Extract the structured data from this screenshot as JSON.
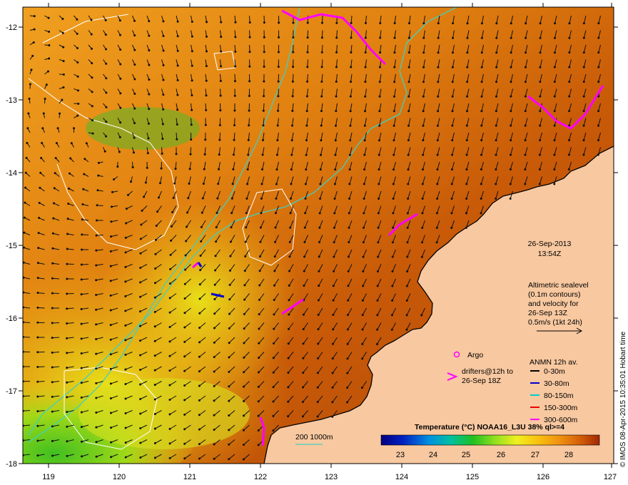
{
  "map": {
    "date": "26-Sep-2013",
    "time": "13:54Z",
    "x_ticks": [
      "119",
      "120",
      "121",
      "122",
      "123",
      "124",
      "125",
      "126",
      "127"
    ],
    "y_ticks": [
      "-12",
      "-13",
      "-14",
      "-15",
      "-16",
      "-17",
      "-18"
    ],
    "altimetry_note": [
      "Altimetric sealevel",
      "(0.1m contours)",
      "and velocity for",
      "26-Sep 13Z",
      "0.5m/s (1kt 24h)"
    ],
    "argo_label": "Argo",
    "drifters_label": [
      "drifters@12h to",
      "26-Sep 18Z"
    ],
    "anmn_title": "ANMN 12h av.",
    "anmn_legend": [
      {
        "label": "0-30m",
        "color": "#000000"
      },
      {
        "label": "30-80m",
        "color": "#0000cc"
      },
      {
        "label": "80-150m",
        "color": "#00cccc"
      },
      {
        "label": "150-300m",
        "color": "#ee0000"
      },
      {
        "label": "300-600m",
        "color": "#ff00ff"
      }
    ],
    "isobath_label": "200  1000m",
    "colorbar_title": "Temperature (°C) NOAA16_L3U 38% ql>=4",
    "colorbar_ticks": [
      "23",
      "24",
      "25",
      "26",
      "27",
      "28"
    ],
    "credit": "© IMOS 08-Apr-2015 10:35:01 Hobart time",
    "colors": {
      "land": "#f8c8a0",
      "argo": "#ff00ff",
      "drifter": "#ff00ff",
      "isobath": "#40d0c0",
      "sealevel_contour": "#ffffff"
    }
  }
}
